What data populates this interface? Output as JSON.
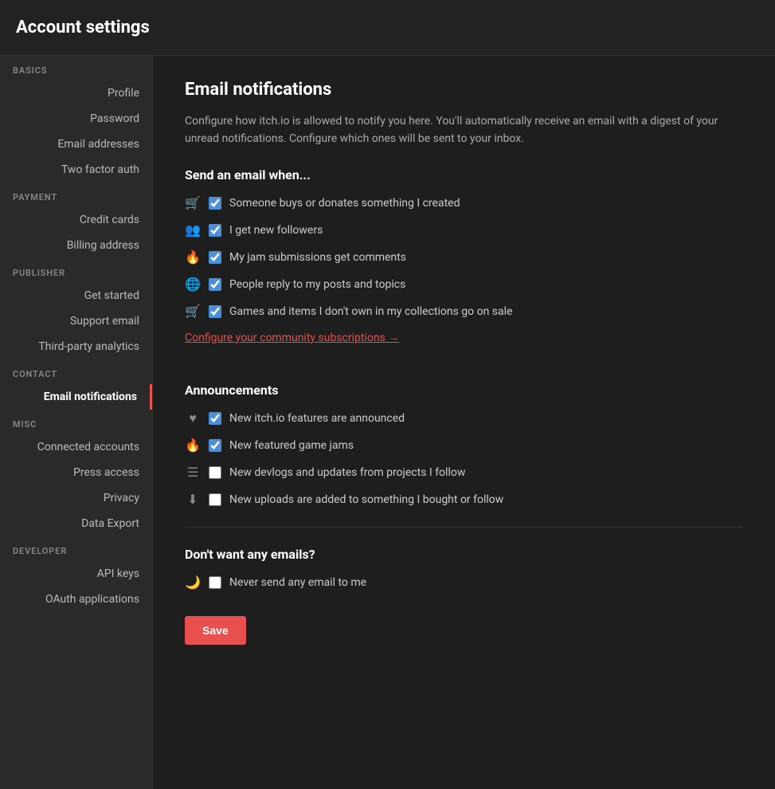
{
  "header": {
    "title": "Account settings"
  },
  "sidebar": {
    "sections": [
      {
        "label": "BASICS",
        "items": [
          {
            "id": "profile",
            "label": "Profile",
            "active": false
          },
          {
            "id": "password",
            "label": "Password",
            "active": false
          },
          {
            "id": "email-addresses",
            "label": "Email addresses",
            "active": false
          },
          {
            "id": "two-factor-auth",
            "label": "Two factor auth",
            "active": false
          }
        ]
      },
      {
        "label": "PAYMENT",
        "items": [
          {
            "id": "credit-cards",
            "label": "Credit cards",
            "active": false
          },
          {
            "id": "billing-address",
            "label": "Billing address",
            "active": false
          }
        ]
      },
      {
        "label": "PUBLISHER",
        "items": [
          {
            "id": "get-started",
            "label": "Get started",
            "active": false
          },
          {
            "id": "support-email",
            "label": "Support email",
            "active": false
          },
          {
            "id": "third-party-analytics",
            "label": "Third-party analytics",
            "active": false
          }
        ]
      },
      {
        "label": "CONTACT",
        "items": [
          {
            "id": "email-notifications",
            "label": "Email notifications",
            "active": true
          }
        ]
      },
      {
        "label": "MISC",
        "items": [
          {
            "id": "connected-accounts",
            "label": "Connected accounts",
            "active": false
          },
          {
            "id": "press-access",
            "label": "Press access",
            "active": false
          },
          {
            "id": "privacy",
            "label": "Privacy",
            "active": false
          },
          {
            "id": "data-export",
            "label": "Data Export",
            "active": false
          }
        ]
      },
      {
        "label": "DEVELOPER",
        "items": [
          {
            "id": "api-keys",
            "label": "API keys",
            "active": false
          },
          {
            "id": "oauth-applications",
            "label": "OAuth applications",
            "active": false
          }
        ]
      }
    ]
  },
  "content": {
    "page_title": "Email notifications",
    "description": "Configure how itch.io is allowed to notify you here. You'll automatically receive an email with a digest of your unread notifications. Configure which ones will be sent to your inbox.",
    "send_when_label": "Send an email when...",
    "send_when_items": [
      {
        "id": "buys-donates",
        "label": "Someone buys or donates something I created",
        "checked": true,
        "icon": "🛒"
      },
      {
        "id": "new-followers",
        "label": "I get new followers",
        "checked": true,
        "icon": "👥"
      },
      {
        "id": "jam-comments",
        "label": "My jam submissions get comments",
        "checked": true,
        "icon": "🔥"
      },
      {
        "id": "replies",
        "label": "People reply to my posts and topics",
        "checked": true,
        "icon": "🌐"
      },
      {
        "id": "on-sale",
        "label": "Games and items I don't own in my collections go on sale",
        "checked": true,
        "icon": "🛒"
      }
    ],
    "community_link": "Configure your community subscriptions →",
    "announcements_title": "Announcements",
    "announcements_items": [
      {
        "id": "new-features",
        "label": "New itch.io features are announced",
        "checked": true,
        "icon": "♥"
      },
      {
        "id": "featured-jams",
        "label": "New featured game jams",
        "checked": true,
        "icon": "🔥"
      },
      {
        "id": "devlogs",
        "label": "New devlogs and updates from projects I follow",
        "checked": false,
        "icon": "☰"
      },
      {
        "id": "new-uploads",
        "label": "New uploads are added to something I bought or follow",
        "checked": false,
        "icon": "⬇"
      }
    ],
    "dont_want_title": "Don't want any emails?",
    "dont_want_items": [
      {
        "id": "never-send",
        "label": "Never send any email to me",
        "checked": false,
        "icon": "🌙"
      }
    ],
    "save_button": "Save"
  }
}
